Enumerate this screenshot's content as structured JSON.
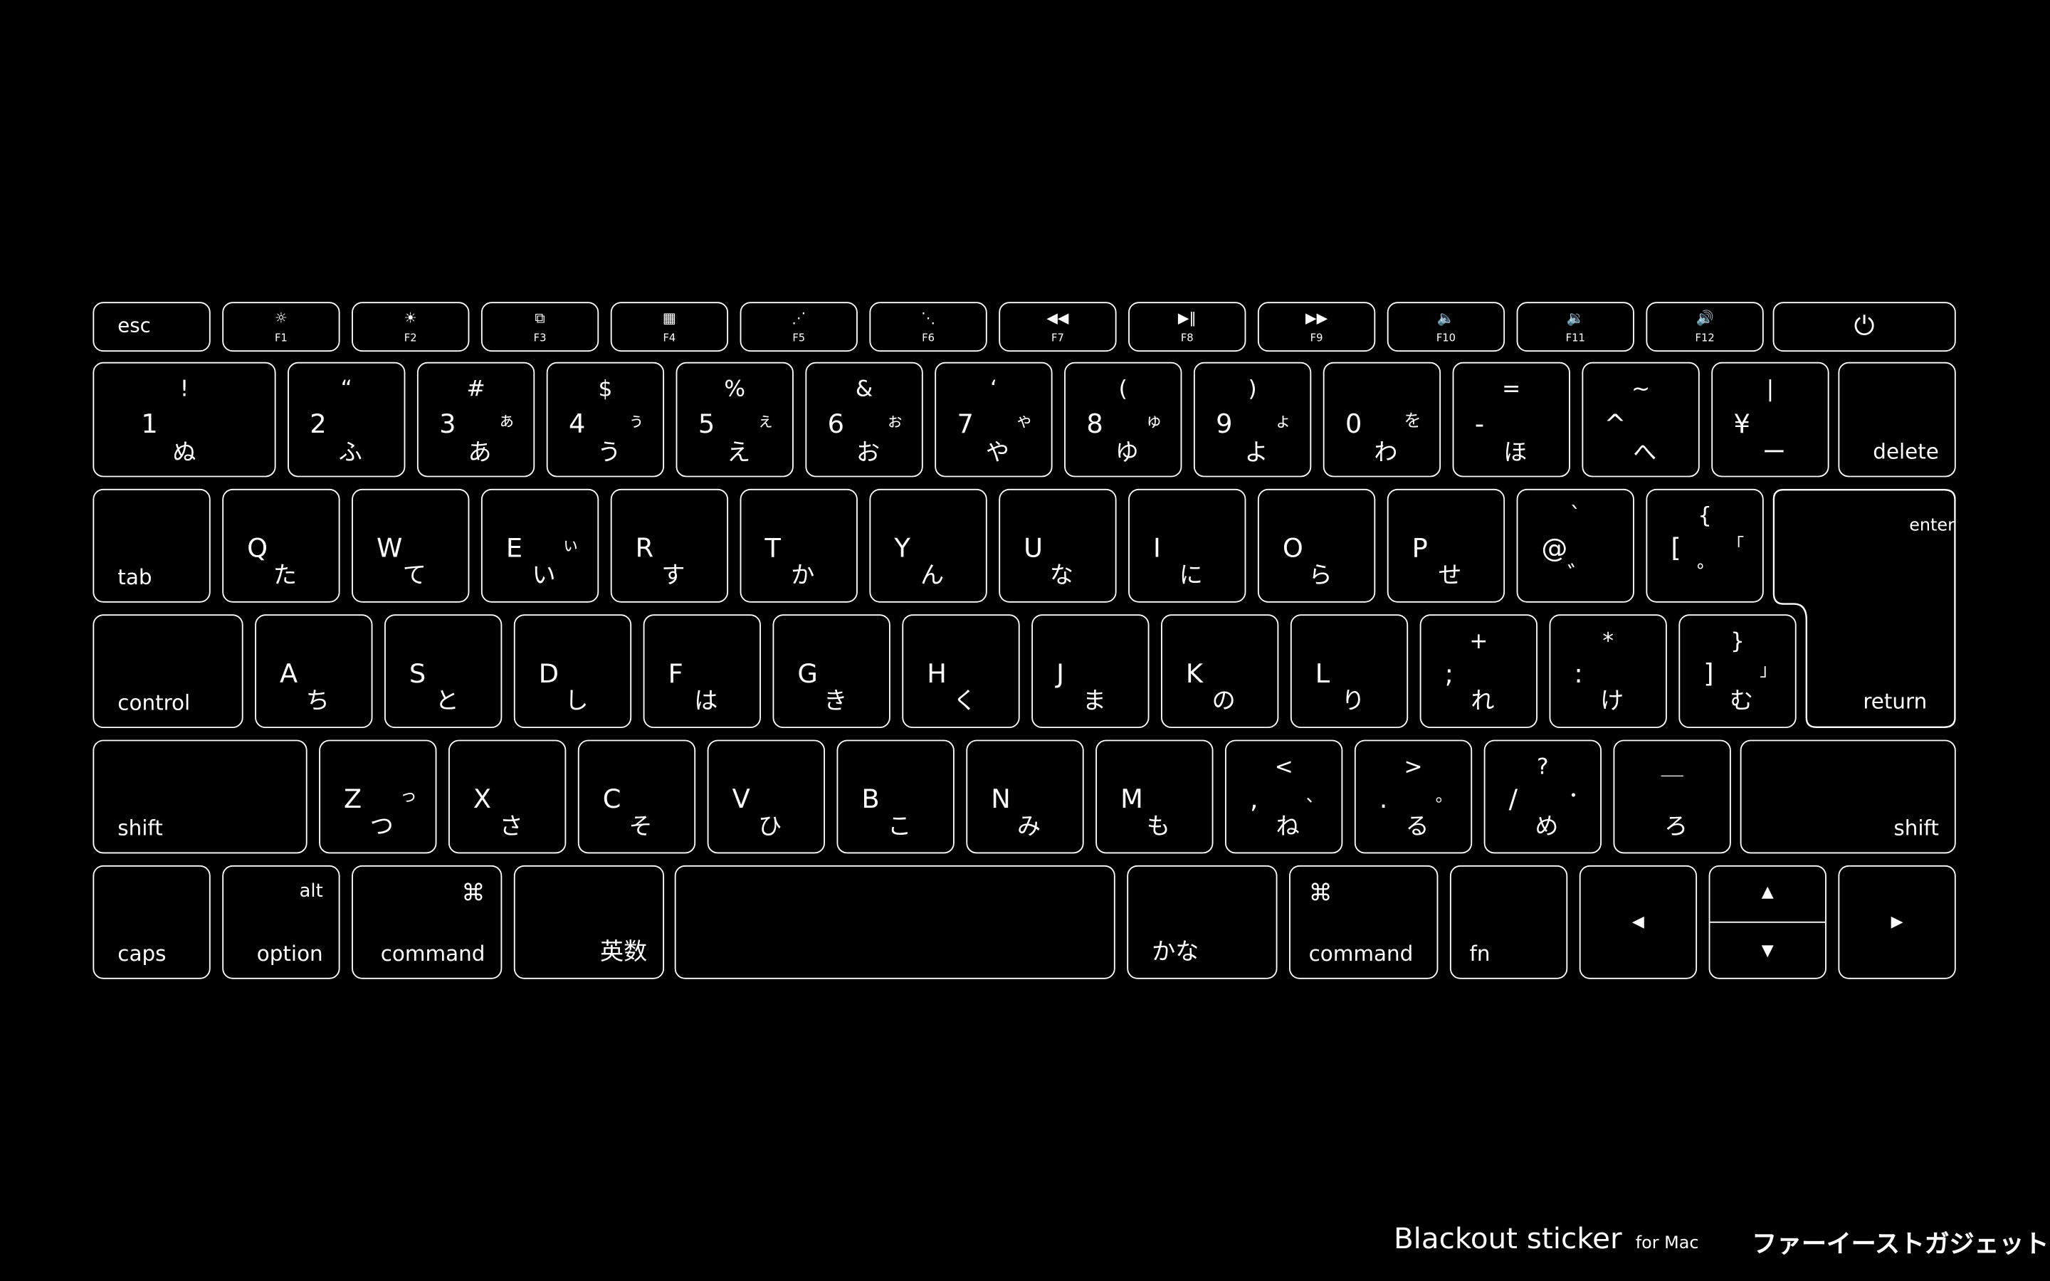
{
  "function_row": {
    "esc": "esc",
    "keys": [
      {
        "icon": "☼",
        "label": "F1",
        "icon_name": "brightness-down-icon"
      },
      {
        "icon": "☀",
        "label": "F2",
        "icon_name": "brightness-up-icon"
      },
      {
        "icon": "⧉",
        "label": "F3",
        "icon_name": "mission-control-icon"
      },
      {
        "icon": "▦",
        "label": "F4",
        "icon_name": "launchpad-icon"
      },
      {
        "icon": "⋰",
        "label": "F5",
        "icon_name": "keyboard-light-down-icon"
      },
      {
        "icon": "⋱",
        "label": "F6",
        "icon_name": "keyboard-light-up-icon"
      },
      {
        "icon": "◀◀",
        "label": "F7",
        "icon_name": "rewind-icon"
      },
      {
        "icon": "▶‖",
        "label": "F8",
        "icon_name": "play-pause-icon"
      },
      {
        "icon": "▶▶",
        "label": "F9",
        "icon_name": "fast-forward-icon"
      },
      {
        "icon": "🔈",
        "label": "F10",
        "icon_name": "mute-icon"
      },
      {
        "icon": "🔉",
        "label": "F11",
        "icon_name": "volume-down-icon"
      },
      {
        "icon": "🔊",
        "label": "F12",
        "icon_name": "volume-up-icon"
      }
    ],
    "power_icon": "⏻"
  },
  "number_row": {
    "keys": [
      {
        "shift": "!",
        "main": "1",
        "kana": "ぬ",
        "small": ""
      },
      {
        "shift": "“",
        "main": "2",
        "kana": "ふ",
        "small": ""
      },
      {
        "shift": "#",
        "main": "3",
        "kana": "あ",
        "small": "ぁ"
      },
      {
        "shift": "$",
        "main": "4",
        "kana": "う",
        "small": "ぅ"
      },
      {
        "shift": "%",
        "main": "5",
        "kana": "え",
        "small": "ぇ"
      },
      {
        "shift": "&",
        "main": "6",
        "kana": "お",
        "small": "ぉ"
      },
      {
        "shift": "‘",
        "main": "7",
        "kana": "や",
        "small": "ゃ"
      },
      {
        "shift": "(",
        "main": "8",
        "kana": "ゆ",
        "small": "ゅ"
      },
      {
        "shift": ")",
        "main": "9",
        "kana": "よ",
        "small": "ょ"
      },
      {
        "shift": "",
        "main": "0",
        "kana": "わ",
        "small": "を"
      },
      {
        "shift": "=",
        "main": "-",
        "kana": "ほ",
        "small": ""
      },
      {
        "shift": "~",
        "main": "^",
        "kana": "へ",
        "small": ""
      },
      {
        "shift": "|",
        "main": "¥",
        "kana": "ー",
        "small": ""
      }
    ],
    "delete": "delete"
  },
  "q_row": {
    "tab": "tab",
    "keys": [
      {
        "main": "Q",
        "kana": "た",
        "small": ""
      },
      {
        "main": "W",
        "kana": "て",
        "small": ""
      },
      {
        "main": "E",
        "kana": "い",
        "small": "ぃ"
      },
      {
        "main": "R",
        "kana": "す",
        "small": ""
      },
      {
        "main": "T",
        "kana": "か",
        "small": ""
      },
      {
        "main": "Y",
        "kana": "ん",
        "small": ""
      },
      {
        "main": "U",
        "kana": "な",
        "small": ""
      },
      {
        "main": "I",
        "kana": "に",
        "small": ""
      },
      {
        "main": "O",
        "kana": "ら",
        "small": ""
      },
      {
        "main": "P",
        "kana": "せ",
        "small": ""
      },
      {
        "shift": "`",
        "main": "@",
        "kana": "゛",
        "small": ""
      },
      {
        "shift": "{",
        "main": "[",
        "kana": "゜",
        "small": "「"
      }
    ],
    "enter": "enter"
  },
  "a_row": {
    "control": "control",
    "keys": [
      {
        "main": "A",
        "kana": "ち",
        "small": ""
      },
      {
        "main": "S",
        "kana": "と",
        "small": ""
      },
      {
        "main": "D",
        "kana": "し",
        "small": ""
      },
      {
        "main": "F",
        "kana": "は",
        "small": ""
      },
      {
        "main": "G",
        "kana": "き",
        "small": ""
      },
      {
        "main": "H",
        "kana": "く",
        "small": ""
      },
      {
        "main": "J",
        "kana": "ま",
        "small": ""
      },
      {
        "main": "K",
        "kana": "の",
        "small": ""
      },
      {
        "main": "L",
        "kana": "り",
        "small": ""
      },
      {
        "shift": "+",
        "main": ";",
        "kana": "れ",
        "small": ""
      },
      {
        "shift": "*",
        "main": ":",
        "kana": "け",
        "small": ""
      },
      {
        "shift": "}",
        "main": "]",
        "kana": "む",
        "small": "」"
      }
    ],
    "return": "return"
  },
  "z_row": {
    "shift_left": "shift",
    "keys": [
      {
        "main": "Z",
        "kana": "つ",
        "small": "っ"
      },
      {
        "main": "X",
        "kana": "さ",
        "small": ""
      },
      {
        "main": "C",
        "kana": "そ",
        "small": ""
      },
      {
        "main": "V",
        "kana": "ひ",
        "small": ""
      },
      {
        "main": "B",
        "kana": "こ",
        "small": ""
      },
      {
        "main": "N",
        "kana": "み",
        "small": ""
      },
      {
        "main": "M",
        "kana": "も",
        "small": ""
      },
      {
        "shift": "<",
        "main": ",",
        "kana": "ね",
        "small": "、"
      },
      {
        "shift": ">",
        "main": ".",
        "kana": "る",
        "small": "。"
      },
      {
        "shift": "?",
        "main": "/",
        "kana": "め",
        "small": "・"
      },
      {
        "shift": "＿",
        "main": "",
        "kana": "ろ",
        "small": ""
      }
    ],
    "shift_right": "shift"
  },
  "bottom_row": {
    "caps": "caps",
    "option": "option",
    "alt": "alt",
    "command_symbol": "⌘",
    "command": "command",
    "eisu": "英数",
    "kana": "かな",
    "fn": "fn",
    "left_arrow": "◀",
    "up_arrow": "▲",
    "down_arrow": "▼",
    "right_arrow": "▶"
  },
  "footer": {
    "title": "Blackout sticker",
    "subtitle": "for Mac",
    "brand": "ファーイーストガジェット"
  }
}
